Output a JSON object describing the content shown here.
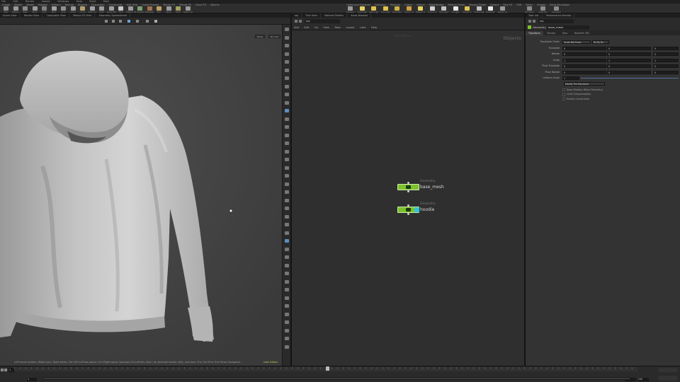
{
  "menubar": {
    "items": [
      "File",
      "Edit",
      "Render",
      "Assets",
      "Windows",
      "Help",
      "Build",
      "Main"
    ]
  },
  "shelf_left": {
    "tabs": [
      "Create",
      "Modify",
      "Model",
      "Polygon",
      "Deform",
      "Texture",
      "Rigging",
      "Characters",
      "Constraints",
      "Hair Utils",
      "Guide Process",
      "Terrain FX",
      "Simple FX",
      "Cloud FX",
      "Volume"
    ],
    "tools": [
      {
        "label": "Box",
        "icon": "box-icon",
        "color": "#8a8a8a"
      },
      {
        "label": "Sphere",
        "icon": "sphere-icon",
        "color": "#9a9a9a"
      },
      {
        "label": "Tube",
        "icon": "tube-icon",
        "color": "#8a8a8a"
      },
      {
        "label": "Torus",
        "icon": "torus-icon",
        "color": "#9a9a9a"
      },
      {
        "label": "Grid",
        "icon": "grid-icon",
        "color": "#7f7f7f"
      },
      {
        "label": "Null",
        "icon": "null-icon",
        "color": "#a0a0a0"
      },
      {
        "label": "Line",
        "icon": "line-icon",
        "color": "#8f8f8f"
      },
      {
        "label": "Circle",
        "icon": "circle-icon",
        "color": "#9a9a9a"
      },
      {
        "label": "Curve",
        "icon": "curve-icon",
        "color": "#b0a070"
      },
      {
        "label": "Draw Curve",
        "icon": "draw-curve-icon",
        "color": "#a0a0a0"
      },
      {
        "label": "Path",
        "icon": "path-icon",
        "color": "#9a9a9a"
      },
      {
        "label": "Spray Paint",
        "icon": "spray-paint-icon",
        "color": "#a0a0a0"
      },
      {
        "label": "Font",
        "icon": "font-icon",
        "color": "#c8c8c8"
      },
      {
        "label": "Platonic Solids",
        "icon": "platonic-icon",
        "color": "#9a9a9a"
      },
      {
        "label": "L-System",
        "icon": "lsystem-icon",
        "color": "#7aa070"
      },
      {
        "label": "Metaball",
        "icon": "metaball-icon",
        "color": "#a07050"
      },
      {
        "label": "File",
        "icon": "file-icon",
        "color": "#c0a060"
      },
      {
        "label": "Spiral",
        "icon": "spiral-icon",
        "color": "#9a9a9a"
      },
      {
        "label": "Helix",
        "icon": "helix-icon",
        "color": "#a0a060"
      },
      {
        "label": "Sketch Volume",
        "icon": "sketch-icon",
        "color": "#9a9a9a"
      }
    ]
  },
  "shelf_right": {
    "tabs": [
      "Lights and Cameras",
      "Collisions",
      "Particles",
      "Grains",
      "Vellum",
      "Rigid Bodies",
      "Particle Fluids",
      "Viscous Fluids",
      "Oceans",
      "Pyro FX",
      "FEM",
      "Wires",
      "Crowds",
      "Drive Simulation"
    ],
    "tools": [
      {
        "label": "Camera",
        "icon": "camera-icon",
        "color": "#9a9a9a"
      },
      {
        "label": "Point Light",
        "icon": "point-light-icon",
        "color": "#e8d060"
      },
      {
        "label": "Spot Light",
        "icon": "spot-light-icon",
        "color": "#e0c050"
      },
      {
        "label": "Area Light",
        "icon": "area-light-icon",
        "color": "#e0c050"
      },
      {
        "label": "Geometry Light",
        "icon": "geo-light-icon",
        "color": "#d0b040"
      },
      {
        "label": "Volume Light",
        "icon": "volume-light-icon",
        "color": "#d0a040"
      },
      {
        "label": "Distant Light",
        "icon": "distant-light-icon",
        "color": "#e8d060"
      },
      {
        "label": "Environment Light",
        "icon": "env-light-icon",
        "color": "#d0d0d0"
      },
      {
        "label": "Sky Light",
        "icon": "sky-light-icon",
        "color": "#c0c0c0"
      },
      {
        "label": "GI Light",
        "icon": "gi-light-icon",
        "color": "#e8e8e8"
      },
      {
        "label": "Caustic Light",
        "icon": "caustic-light-icon",
        "color": "#e0c050"
      },
      {
        "label": "Portal Light",
        "icon": "portal-light-icon",
        "color": "#c0c0c0"
      },
      {
        "label": "Ambient Light",
        "icon": "ambient-light-icon",
        "color": "#e8e8e8"
      },
      {
        "label": "Stereo Camera",
        "icon": "stereo-camera-icon",
        "color": "#9a9a9a"
      }
    ],
    "extra_tools": [
      {
        "label": "VR Camera",
        "icon": "vr-camera-icon"
      },
      {
        "label": "Switcher",
        "icon": "switcher-icon"
      },
      {
        "label": "Gamepad Camera",
        "icon": "gamepad-icon"
      }
    ]
  },
  "viewport": {
    "tabs": [
      "Scene View",
      "Render View",
      "Composite View",
      "Motion FX View",
      "Geometry Spreadsheet"
    ],
    "camera_menu": "Persp",
    "cam_menu": "No cam",
    "status": "Left mouse tumbles. Middle pans. Right dollies. Ctrl+Alt+Left box-zooms. Ctrl+Right zooms. Spacebar-Ctrl-Left tilts. Hold L for alternate tumble, dolly, and zoom. M or Alt+M for First Person Navigation.",
    "version": "Indie Edition"
  },
  "network": {
    "tabs": [
      "obj",
      "Tree View",
      "Material Palette",
      "Asset Browser"
    ],
    "path": "obj",
    "menu": [
      "Add",
      "Edit",
      "Go",
      "View",
      "Tools",
      "Layout",
      "Labs",
      "Help"
    ],
    "context_label": "Indie Edition",
    "watermark": "Objects",
    "nodes": [
      {
        "type": "Geometry",
        "name": "base_mesh",
        "color": "#7dc22e"
      },
      {
        "type": "Geometry",
        "name": "hoodie",
        "color": "#7dc22e"
      }
    ]
  },
  "parameters": {
    "tabs": [
      "Take List",
      "Performance Monitor"
    ],
    "path": "obj",
    "node_type": "Geometry",
    "node_name": "base_mesh",
    "subtabs": [
      "Transform",
      "Render",
      "Misc",
      "Redshift OBJ"
    ],
    "rows": [
      {
        "label": "Transform Order",
        "values": [
          "Scale Rot Trans",
          "Rx Ry Rz"
        ]
      },
      {
        "label": "Translate",
        "values": [
          "0",
          "0",
          "0"
        ]
      },
      {
        "label": "Rotate",
        "values": [
          "0",
          "0",
          "0"
        ]
      },
      {
        "label": "Scale",
        "values": [
          "1",
          "1",
          "1"
        ]
      },
      {
        "label": "Pivot Translate",
        "values": [
          "0",
          "0",
          "0"
        ]
      },
      {
        "label": "Pivot Rotate",
        "values": [
          "0",
          "0",
          "0"
        ]
      },
      {
        "label": "Uniform Scale",
        "values": [
          "1"
        ]
      }
    ],
    "modify_menu": "Modify Pre-Transform",
    "checkboxes": [
      "Keep Position When Parenting",
      "Child Compensation",
      "Enable Constraints"
    ]
  },
  "timeline": {
    "frame": "1",
    "start": "1",
    "end": "240",
    "end_field": "240",
    "range_end": "240"
  }
}
